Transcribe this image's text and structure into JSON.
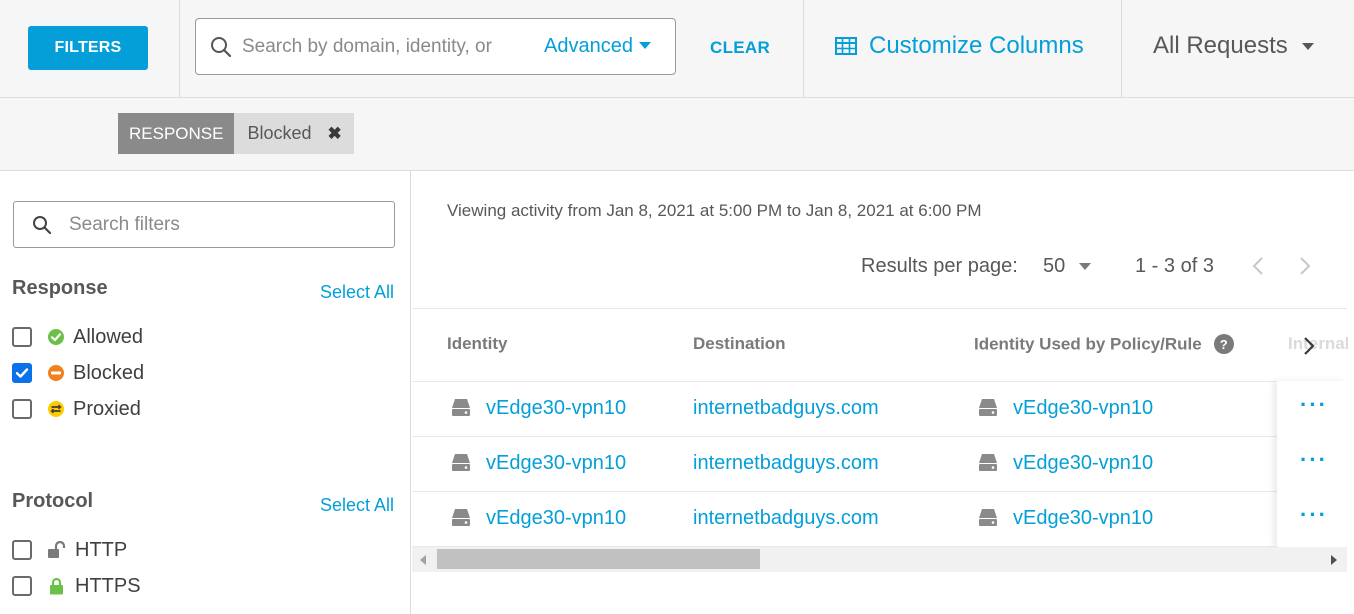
{
  "topbar": {
    "filters_label": "FILTERS",
    "search_placeholder": "Search by domain, identity, or",
    "advanced_label": "Advanced",
    "clear_label": "CLEAR",
    "customize_label": "Customize Columns",
    "scope_label": "All Requests"
  },
  "chips": [
    {
      "key": "RESPONSE",
      "value": "Blocked"
    }
  ],
  "sidebar": {
    "search_placeholder": "Search filters",
    "sections": [
      {
        "title": "Response",
        "select_all": "Select All",
        "options": [
          {
            "label": "Allowed",
            "checked": false,
            "icon": "check-circle-icon",
            "color": "#6cc04a"
          },
          {
            "label": "Blocked",
            "checked": true,
            "icon": "minus-circle-icon",
            "color": "#f0821e"
          },
          {
            "label": "Proxied",
            "checked": false,
            "icon": "proxy-arrows-icon",
            "color": "#ffcc00"
          }
        ]
      },
      {
        "title": "Protocol",
        "select_all": "Select All",
        "options": [
          {
            "label": "HTTP",
            "checked": false,
            "icon": "unlock-icon",
            "color": "#7a7a7a"
          },
          {
            "label": "HTTPS",
            "checked": false,
            "icon": "lock-icon",
            "color": "#6cc04a"
          }
        ]
      }
    ]
  },
  "main": {
    "viewing_text": "Viewing activity from Jan 8, 2021 at 5:00 PM to Jan 8, 2021 at 6:00 PM",
    "results_per_page_label": "Results per page:",
    "results_per_page_value": "50",
    "range_text": "1 - 3 of 3",
    "columns": [
      "Identity",
      "Destination",
      "Identity Used by Policy/Rule",
      "Internal"
    ],
    "help_glyph": "?",
    "rows": [
      {
        "identity": "vEdge30-vpn10",
        "destination": "internetbadguys.com",
        "policy_identity": "vEdge30-vpn10",
        "actions": "···"
      },
      {
        "identity": "vEdge30-vpn10",
        "destination": "internetbadguys.com",
        "policy_identity": "vEdge30-vpn10",
        "actions": "···"
      },
      {
        "identity": "vEdge30-vpn10",
        "destination": "internetbadguys.com",
        "policy_identity": "vEdge30-vpn10",
        "actions": "···"
      }
    ]
  },
  "colors": {
    "accent": "#049fd9",
    "chip_key_bg": "#8a8a8a",
    "checkbox_checked": "#0a72e8"
  }
}
